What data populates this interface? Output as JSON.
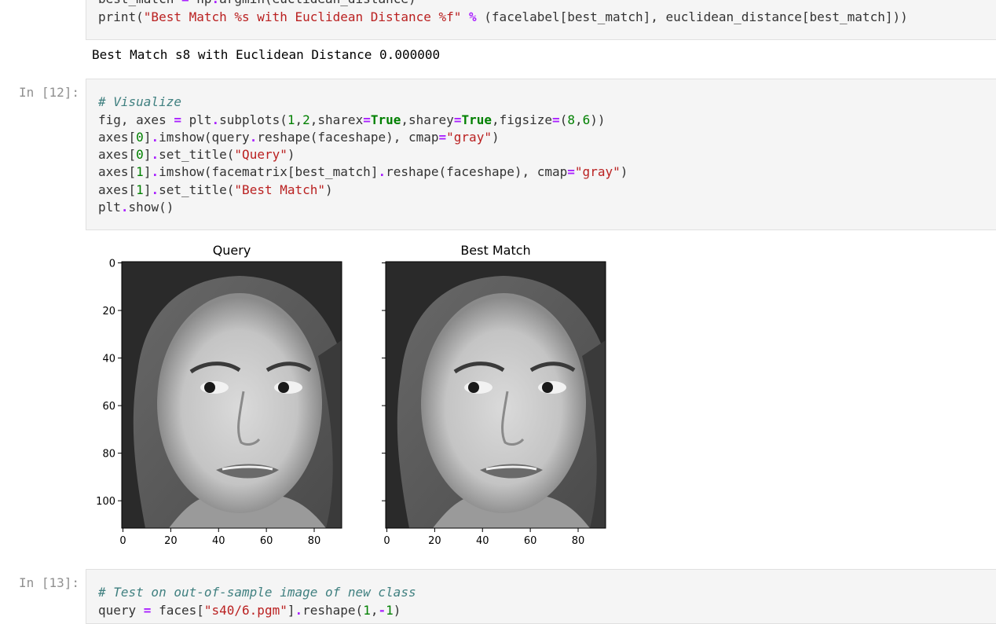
{
  "cells": {
    "prev": {
      "code_line1": "best_match = np.argmin(euclidean_distance)",
      "code_line2": "print(\"Best Match %s with Euclidean Distance %f\" % (facelabel[best_match], euclidean_distance[best_match]))",
      "output": "Best Match s8 with Euclidean Distance 0.000000"
    },
    "c12": {
      "prompt": "In [12]:",
      "lines": [
        "# Visualize",
        "fig, axes = plt.subplots(1,2,sharex=True,sharey=True,figsize=(8,6))",
        "axes[0].imshow(query.reshape(faceshape), cmap=\"gray\")",
        "axes[0].set_title(\"Query\")",
        "axes[1].imshow(facematrix[best_match].reshape(faceshape), cmap=\"gray\")",
        "axes[1].set_title(\"Best Match\")",
        "plt.show()"
      ]
    },
    "c13": {
      "prompt": "In [13]:",
      "lines": [
        "# Test on out-of-sample image of new class",
        "query = faces[\"s40/6.pgm\"].reshape(1,-1)"
      ]
    }
  },
  "chart_data": [
    {
      "type": "image",
      "title": "Query",
      "x_ticks": [
        0,
        20,
        40,
        60,
        80
      ],
      "y_ticks": [
        0,
        20,
        40,
        60,
        80,
        100
      ],
      "xlim": [
        -0.5,
        91.5
      ],
      "ylim": [
        111.5,
        -0.5
      ],
      "cmap": "gray"
    },
    {
      "type": "image",
      "title": "Best Match",
      "x_ticks": [
        0,
        20,
        40,
        60,
        80
      ],
      "y_ticks": [
        0,
        20,
        40,
        60,
        80,
        100
      ],
      "xlim": [
        -0.5,
        91.5
      ],
      "ylim": [
        111.5,
        -0.5
      ],
      "cmap": "gray"
    }
  ]
}
